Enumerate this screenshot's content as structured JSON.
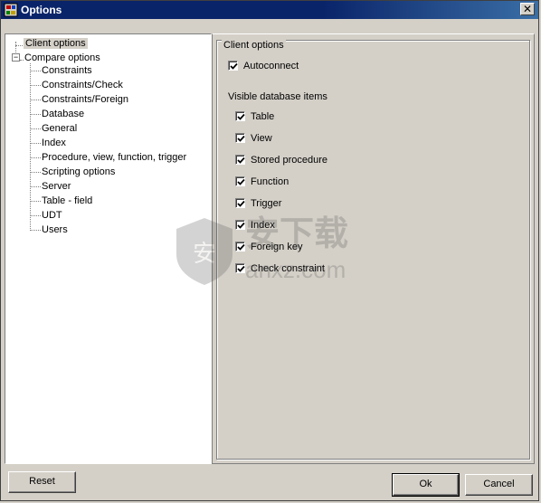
{
  "window": {
    "title": "Options",
    "close_glyph": "✕"
  },
  "tree": {
    "root_item": "Client options",
    "compare_item": "Compare options",
    "children": [
      "Constraints",
      "Constraints/Check",
      "Constraints/Foreign",
      "Database",
      "General",
      "Index",
      "Procedure, view, function, trigger",
      "Scripting options",
      "Server",
      "Table - field",
      "UDT",
      "Users"
    ]
  },
  "panel": {
    "group_title": "Client options",
    "autoconnect": {
      "label": "Autoconnect",
      "checked": true
    },
    "visible_items_label": "Visible database items",
    "items": [
      {
        "label": "Table",
        "checked": true
      },
      {
        "label": "View",
        "checked": true
      },
      {
        "label": "Stored procedure",
        "checked": true
      },
      {
        "label": "Function",
        "checked": true
      },
      {
        "label": "Trigger",
        "checked": true
      },
      {
        "label": "Index",
        "checked": true
      },
      {
        "label": "Foreign key",
        "checked": true
      },
      {
        "label": "Check constraint",
        "checked": true
      }
    ]
  },
  "buttons": {
    "reset": "Reset",
    "ok": "Ok",
    "cancel": "Cancel"
  },
  "watermark": {
    "text": "安下载",
    "subtext": "anxz.com"
  },
  "colors": {
    "titlebar": "#0a246a",
    "face": "#d4d0c8"
  }
}
